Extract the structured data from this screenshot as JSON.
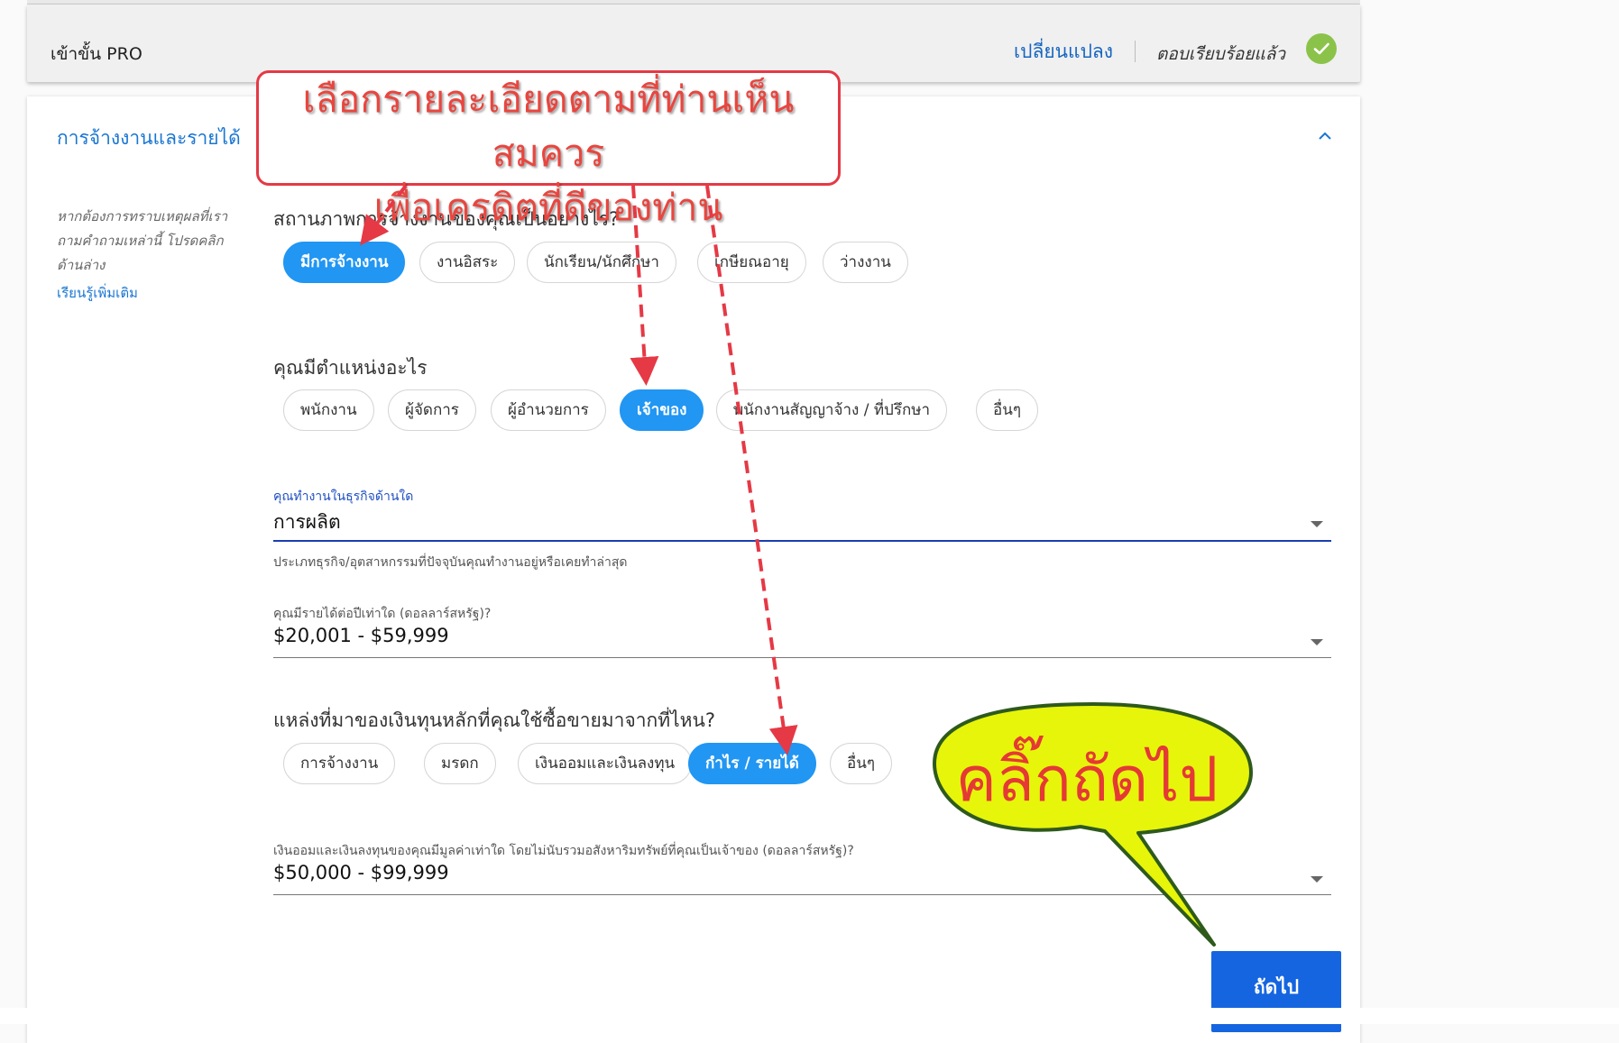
{
  "header": {
    "title": "เข้าขั้น PRO",
    "change_label": "เปลี่ยนแปลง",
    "answered_label": "ตอบเรียบร้อยแล้ว"
  },
  "section": {
    "title": "การจ้างงานและรายได้",
    "side_note": "หากต้องการทราบเหตุผลที่เราถามคำถามเหล่านี้ โปรดคลิกด้านล่าง",
    "learn_more": "เรียนรู้เพิ่มเติม"
  },
  "employment_status": {
    "question": "สถานภาพการจ้างงานของคุณเป็นอย่างไร?",
    "options": [
      "มีการจ้างงาน",
      "งานอิสระ",
      "นักเรียน/นักศึกษา",
      "เกษียณอายุ",
      "ว่างงาน"
    ],
    "selected": "มีการจ้างงาน"
  },
  "position": {
    "question": "คุณมีตำแหน่งอะไร",
    "options": [
      "พนักงาน",
      "ผู้จัดการ",
      "ผู้อำนวยการ",
      "เจ้าของ",
      "พนักงานสัญญาจ้าง / ที่ปรึกษา",
      "อื่นๆ"
    ],
    "selected": "เจ้าของ"
  },
  "industry": {
    "label": "คุณทำงานในธุรกิจด้านใด",
    "value": "การผลิต",
    "helper": "ประเภทธุรกิจ/อุตสาหกรรมที่ปัจจุบันคุณทำงานอยู่หรือเคยทำล่าสุด"
  },
  "income": {
    "label": "คุณมีรายได้ต่อปีเท่าใด (ดอลลาร์สหรัฐ)?",
    "value": "$20,001 - $59,999"
  },
  "funds_source": {
    "question": "แหล่งที่มาของเงินทุนหลักที่คุณใช้ซื้อขายมาจากที่ไหน?",
    "options": [
      "การจ้างงาน",
      "มรดก",
      "เงินออมและเงินลงทุน",
      "กำไร / รายได้",
      "อื่นๆ"
    ],
    "selected": "กำไร / รายได้"
  },
  "savings": {
    "label": "เงินออมและเงินลงทุนของคุณมีมูลค่าเท่าใด โดยไม่นับรวมอสังหาริมทรัพย์ที่คุณเป็นเจ้าของ (ดอลลาร์สหรัฐ)?",
    "value": "$50,000 - $99,999"
  },
  "next_button": "ถัดไป",
  "annotations": {
    "callout_line1": "เลือกรายละเอียดตามที่ท่านเห็นสมควร",
    "callout_line2": "เพื่อเครดิตที่ดีของท่าน",
    "bubble": "คลิ๊กถัดไป"
  },
  "colors": {
    "accent": "#2196f3",
    "link": "#1976d2",
    "button": "#1565e0",
    "success": "#8bc34a",
    "annotation_red": "#e53945",
    "bubble_fill": "#e6f50a",
    "bubble_border": "#2e5a1c"
  },
  "icons": {
    "answered": "check-icon",
    "collapse": "chevron-up-icon",
    "dropdown": "caret-down-icon"
  }
}
